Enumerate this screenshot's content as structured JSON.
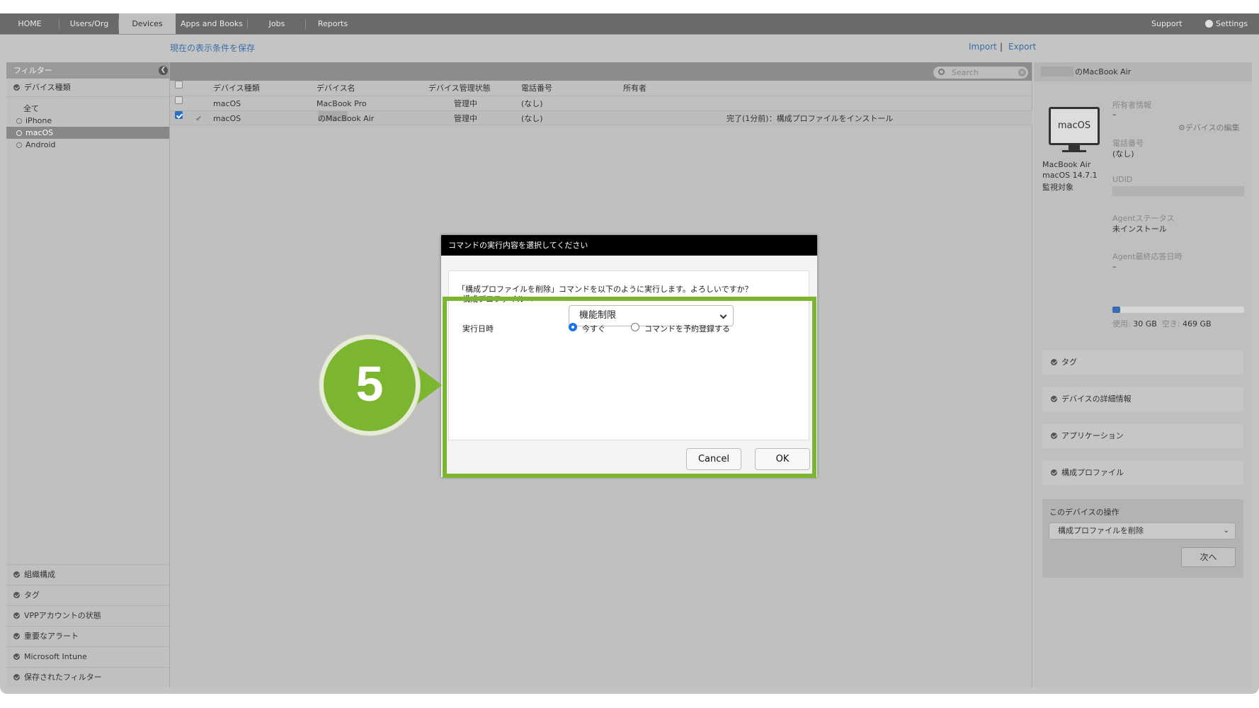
{
  "nav": {
    "tabs": [
      "HOME",
      "Users/Org",
      "Devices",
      "Apps and Books",
      "Jobs",
      "Reports"
    ],
    "support": "Support",
    "settings": "Settings"
  },
  "subbar": {
    "save_filter": "現在の表示条件を保存",
    "import": "Import",
    "sep": "|",
    "export": "Export"
  },
  "filter": {
    "header": "フィルター",
    "device_type_section": "デバイス種類",
    "items": [
      "全て",
      "iPhone",
      "macOS",
      "Android"
    ],
    "bottom_sections": [
      "組織構成",
      "タグ",
      "VPPアカウントの状態",
      "重要なアラート",
      "Microsoft Intune",
      "保存されたフィルター"
    ]
  },
  "table": {
    "search_placeholder": "Search",
    "headers": [
      "デバイス種類",
      "デバイス名",
      "デバイス管理状態",
      "電話番号",
      "所有者"
    ],
    "rows": [
      {
        "type": "macOS",
        "name": "MacBook Pro",
        "state": "管理中",
        "phone": "(なし)",
        "status": ""
      },
      {
        "type": "macOS",
        "name": "のMacBook Air",
        "state": "管理中",
        "phone": "(なし)",
        "status": "完了(1分前)：構成プロファイルをインストール"
      }
    ]
  },
  "details": {
    "title": "のMacBook Air",
    "monitor_label": "macOS",
    "model": "MacBook Air",
    "os": "macOS 14.7.1",
    "supervised": "監視対象",
    "owner_label": "所有者情報",
    "owner_value": "–",
    "edit_link": "デバイスの編集",
    "phone_label": "電話番号",
    "phone_value": "(なし)",
    "udid_label": "UDID",
    "agent_label": "Agentステータス",
    "agent_value": "未インストール",
    "agent_last_label": "Agent最終応答日時",
    "agent_last_value": "–",
    "storage_used_label": "使用:",
    "storage_used": "30 GB",
    "storage_free_label": "空き:",
    "storage_free": "469 GB",
    "storage_fraction": 0.06,
    "sections": [
      "タグ",
      "デバイスの詳細情報",
      "アプリケーション",
      "構成プロファイル"
    ],
    "ops_title": "このデバイスの操作",
    "ops_selected": "構成プロファイルを削除",
    "next_label": "次へ"
  },
  "modal": {
    "title": "コマンドの実行内容を選択してください",
    "message": "「構成プロファイルを削除」コマンドを以下のように実行します。よろしいですか？",
    "profile_label": "構成プロファイル",
    "required_mark": "※",
    "profile_value": "機能制限",
    "schedule_label": "実行日時",
    "option_now": "今すぐ",
    "option_later": "コマンドを予約登録する",
    "cancel": "Cancel",
    "ok": "OK"
  },
  "step": {
    "number": "5",
    "highlight_color": "#7cb52f"
  }
}
